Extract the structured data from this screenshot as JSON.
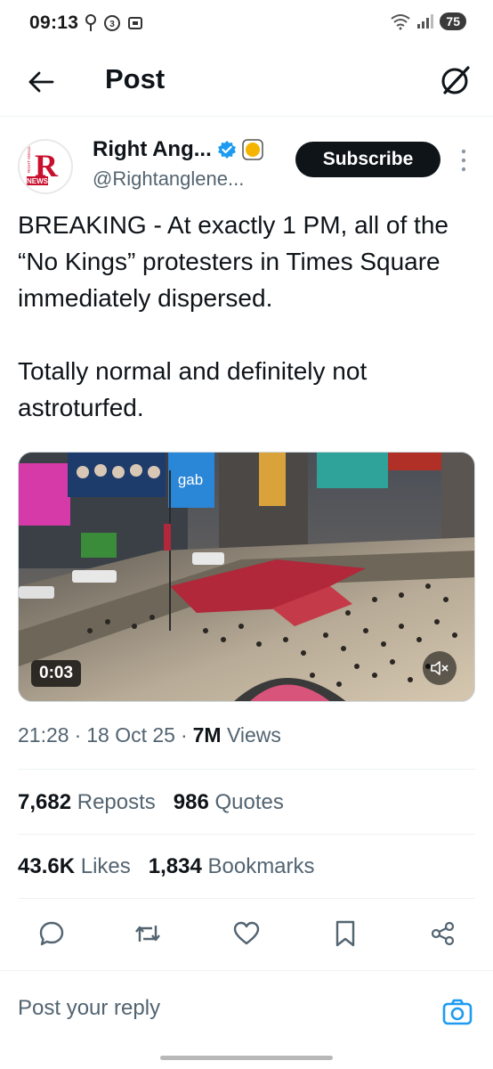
{
  "status_bar": {
    "time": "09:13",
    "battery": "75"
  },
  "header": {
    "title": "Post",
    "back_icon": "arrow-left-icon",
    "grok_icon": "grok-slash-icon"
  },
  "author": {
    "name": "Right Ang...",
    "handle": "@Rightanglene...",
    "avatar_text_top": "RIGHT ANGLE",
    "avatar_letter": "R",
    "avatar_text_bottom": "NEWS",
    "subscribe_label": "Subscribe",
    "verified_color": "#1d9bf0",
    "affiliate_color": "#f4b400"
  },
  "tweet": {
    "line1": "BREAKING - At exactly 1 PM, all of the “No Kings” protesters in Times Square immediately dispersed.",
    "line2": "Totally normal and definitely not astroturfed."
  },
  "media": {
    "duration": "0:03",
    "billboard_text": "gab",
    "mute_icon": "speaker-muted-icon"
  },
  "meta": {
    "time": "21:28",
    "date": "18 Oct 25",
    "views_count": "7M",
    "views_label": "Views",
    "separator": "·"
  },
  "stats": {
    "reposts_count": "7,682",
    "reposts_label": "Reposts",
    "quotes_count": "986",
    "quotes_label": "Quotes",
    "likes_count": "43.6K",
    "likes_label": "Likes",
    "bookmarks_count": "1,834",
    "bookmarks_label": "Bookmarks"
  },
  "reply": {
    "placeholder": "Post your reply"
  },
  "colors": {
    "text": "#0f1419",
    "secondary": "#536471",
    "accent": "#1d9bf0",
    "brand_red": "#c8102e"
  }
}
